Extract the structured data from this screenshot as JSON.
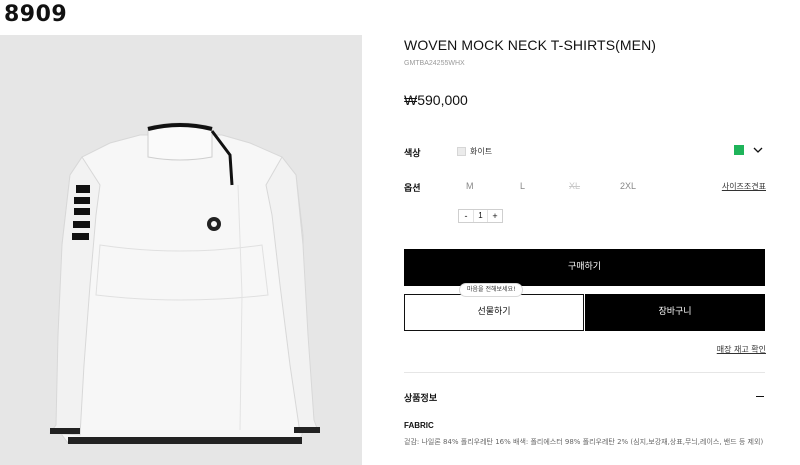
{
  "watermark": "8909",
  "product": {
    "title": "WOVEN MOCK NECK T-SHIRTS(MEN)",
    "sku": "GMTBA24255WHX",
    "price": "₩590,000"
  },
  "options": {
    "color_label": "색상",
    "color_value": "화이트",
    "color_accent": "#1fb45a",
    "size_label": "옵션",
    "sizes": [
      {
        "label": "M",
        "available": true
      },
      {
        "label": "L",
        "available": true
      },
      {
        "label": "XL",
        "available": false
      },
      {
        "label": "2XL",
        "available": true
      }
    ],
    "size_guide": "사이즈조견표",
    "quantity": {
      "minus": "-",
      "value": "1",
      "plus": "+"
    }
  },
  "actions": {
    "buy": "구매하기",
    "gift": "선물하기",
    "gift_tooltip": "마음을 전해보세요!",
    "cart": "장바구니",
    "stock_check": "매장 재고 확인"
  },
  "details": {
    "section_title": "상품정보",
    "fabric_label": "FABRIC",
    "fabric_text": "겉감: 나일론 84% 폴리우레탄 16% 배색: 폴리에스터 98% 폴리우레탄 2% (심지,보강재,상표,무늬,레이스, 밴드 등 제외)"
  },
  "icons": {
    "chevron": "chevron-down-icon",
    "collapse": "minus-icon"
  }
}
